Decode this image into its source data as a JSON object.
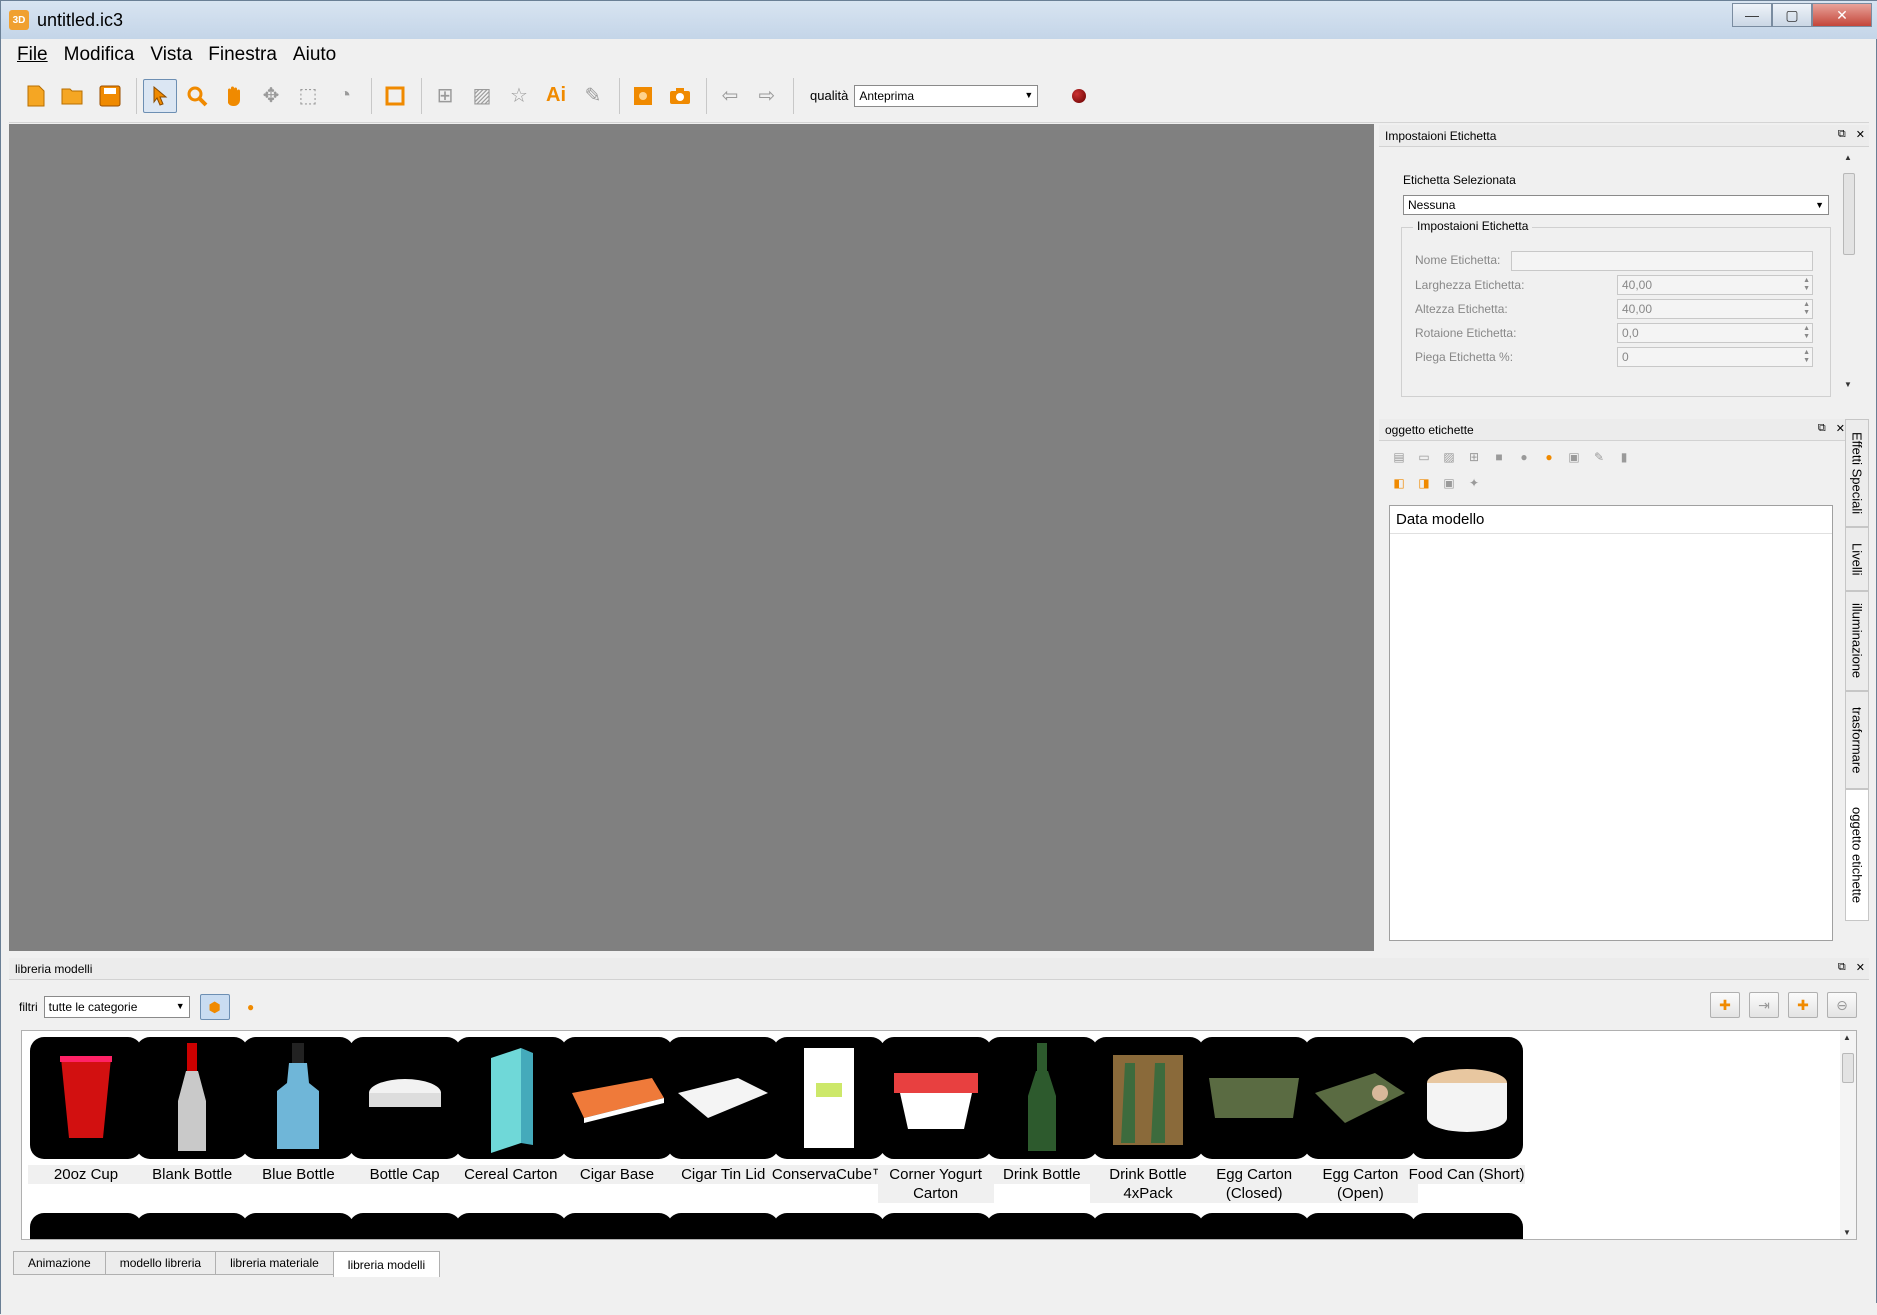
{
  "window": {
    "title": "untitled.ic3",
    "app_icon": "3D",
    "minimize": "—",
    "maximize": "▢",
    "close": "✕"
  },
  "menu": [
    "File",
    "Modifica",
    "Vista",
    "Finestra",
    "Aiuto"
  ],
  "toolbar": {
    "quality_label": "qualità",
    "quality_value": "Anteprima"
  },
  "label_settings": {
    "title": "Impostaioni Etichetta",
    "selected_label": "Etichetta Selezionata",
    "selected_value": "Nessuna",
    "group_title": "Impostaioni Etichetta",
    "fields": [
      {
        "label": "Nome Etichetta:",
        "value": ""
      },
      {
        "label": "Larghezza Etichetta:",
        "value": "40,00"
      },
      {
        "label": "Altezza Etichetta:",
        "value": "40,00"
      },
      {
        "label": "Rotaione Etichetta:",
        "value": "0,0"
      },
      {
        "label": "Piega Etichetta %:",
        "value": "0"
      }
    ]
  },
  "label_objects": {
    "title": "oggetto etichette",
    "tree_header": "Data modello"
  },
  "side_tabs": [
    "Effetti Speciali",
    "Livelli",
    "illuminazione",
    "trasformare",
    "oggetto etichette"
  ],
  "library": {
    "title": "libreria modelli",
    "filter_label": "filtri",
    "filter_value": "tutte le categorie",
    "items": [
      {
        "label": "20oz Cup",
        "color": "#d21010"
      },
      {
        "label": "Blank Bottle",
        "color": "#c9c9c9"
      },
      {
        "label": "Blue Bottle",
        "color": "#6fb6d8"
      },
      {
        "label": "Bottle Cap",
        "color": "#f2f2f2"
      },
      {
        "label": "Cereal Carton",
        "color": "#6fd8d8"
      },
      {
        "label": "Cigar Base",
        "color": "#ef7a3a"
      },
      {
        "label": "Cigar Tin Lid",
        "color": "#f4f4f4"
      },
      {
        "label": "ConservaCube™",
        "color": "#ffffff"
      },
      {
        "label": "Corner Yogurt Carton",
        "color": "#e84040"
      },
      {
        "label": "Drink Bottle",
        "color": "#2d5a2d"
      },
      {
        "label": "Drink Bottle 4xPack",
        "color": "#3d6b3d"
      },
      {
        "label": "Egg Carton (Closed)",
        "color": "#5a6b42"
      },
      {
        "label": "Egg Carton (Open)",
        "color": "#5a6b42"
      },
      {
        "label": "Food Can (Short)",
        "color": "#e8c7a0"
      }
    ]
  },
  "bottom_tabs": [
    "Animazione",
    "modello libreria",
    "libreria materiale",
    "libreria modelli"
  ],
  "dock_buttons": {
    "float": "⧉",
    "close": "✕"
  }
}
